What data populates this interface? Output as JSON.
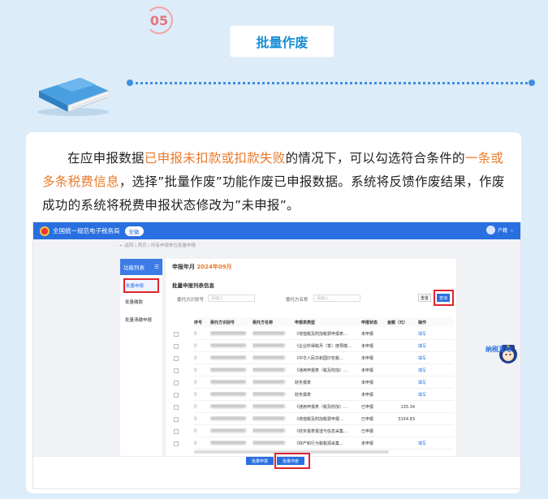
{
  "header": {
    "step_number": "05",
    "title": "批量作废"
  },
  "description": {
    "part1": "在应申报数据",
    "highlight1": "已申报未扣款或扣款失败",
    "part2": "的情况下，可以勾选符合条件的",
    "highlight2": "一条或多条税费信息",
    "part3": "，选择”批量作废”功能作废已申报数据。系统将反馈作废结果，作废成功的系统将税费申报状态修改为”未申报”。"
  },
  "colors": {
    "accent": "#1a8fd6",
    "highlight": "#ea7a2b",
    "primary_button": "#2a6fe0",
    "red_box": "#e0242e",
    "background": "#dcecf8"
  },
  "screenshot": {
    "system_title": "全国统一规范电子税务局",
    "region": "安徽",
    "user_label": "户籍",
    "breadcrumb": "← 返回  |  首页 / 所有申报单位批量申报",
    "sidebar": {
      "header": "功能列表",
      "items": [
        "批量申报",
        "批量缴款",
        "批量清缴申报"
      ]
    },
    "period_label": "申报年月",
    "period_value": "2024年09月",
    "section_title": "批量申报列表信息",
    "query": {
      "label1": "委托方识别号",
      "placeholder1": "请输入",
      "label2": "委托方名称",
      "placeholder2": "请输入",
      "reset": "重置",
      "search": "查询"
    },
    "table": {
      "headers": [
        "序号",
        "委托方识别号",
        "委托方名称",
        "申报表类型",
        "申报状态",
        "金额（元）",
        "操作"
      ],
      "rows": [
        {
          "type": "《增值税及附加税费申报表…",
          "status": "未申报",
          "amount": "",
          "op": "填写"
        },
        {
          "type": "《企业所得税月（季）度预缴…",
          "status": "未申报",
          "amount": "",
          "op": "填写"
        },
        {
          "type": "《中华人民共和国印花税…",
          "status": "未申报",
          "amount": "",
          "op": "填写"
        },
        {
          "type": "《通用申报表（税及附加）…",
          "status": "未申报",
          "amount": "",
          "op": "填写"
        },
        {
          "type": "财务报表",
          "status": "未申报",
          "amount": "",
          "op": "填写"
        },
        {
          "type": "财务报表",
          "status": "未申报",
          "amount": "",
          "op": "填写"
        },
        {
          "type": "《通用申报表（税及附加）…",
          "status": "已申报",
          "amount": "135.34",
          "op": ""
        },
        {
          "type": "《增值税及附加税费申报…",
          "status": "已申报",
          "amount": "3154.83",
          "op": ""
        },
        {
          "type": "《财务报表报送与信息采集…",
          "status": "已申报",
          "amount": "",
          "op": ""
        },
        {
          "type": "《财产和行为税税源采集…",
          "status": "未申报",
          "amount": "",
          "op": "填写"
        }
      ]
    },
    "bottom_buttons": {
      "bulk_submit": "批量申报",
      "bulk_void": "批量作废"
    }
  },
  "mascot": {
    "text": "纳税互动"
  }
}
